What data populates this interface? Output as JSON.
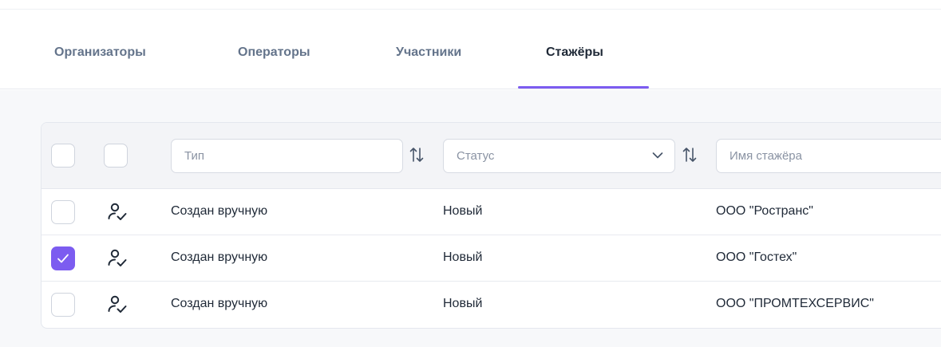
{
  "tabs": [
    {
      "label": "Организаторы",
      "active": false
    },
    {
      "label": "Операторы",
      "active": false
    },
    {
      "label": "Участники",
      "active": false
    },
    {
      "label": "Стажёры",
      "active": true
    }
  ],
  "filters": {
    "type_placeholder": "Тип",
    "status_placeholder": "Статус",
    "name_placeholder": "Имя стажёра"
  },
  "rows": [
    {
      "checked": false,
      "icon": "user-check-icon",
      "type": "Создан вручную",
      "status": "Новый",
      "name": "ООО \"Ространс\""
    },
    {
      "checked": true,
      "icon": "user-check-icon",
      "type": "Создан вручную",
      "status": "Новый",
      "name": "ООО \"Гостех\""
    },
    {
      "checked": false,
      "icon": "user-check-icon",
      "type": "Создан вручную",
      "status": "Новый",
      "name": "ООО \"ПРОМТЕХСЕРВИС\""
    }
  ],
  "colors": {
    "accent": "#7c5cf0",
    "tab_inactive": "#64748b",
    "text": "#1f2937",
    "placeholder": "#8a93a3"
  }
}
